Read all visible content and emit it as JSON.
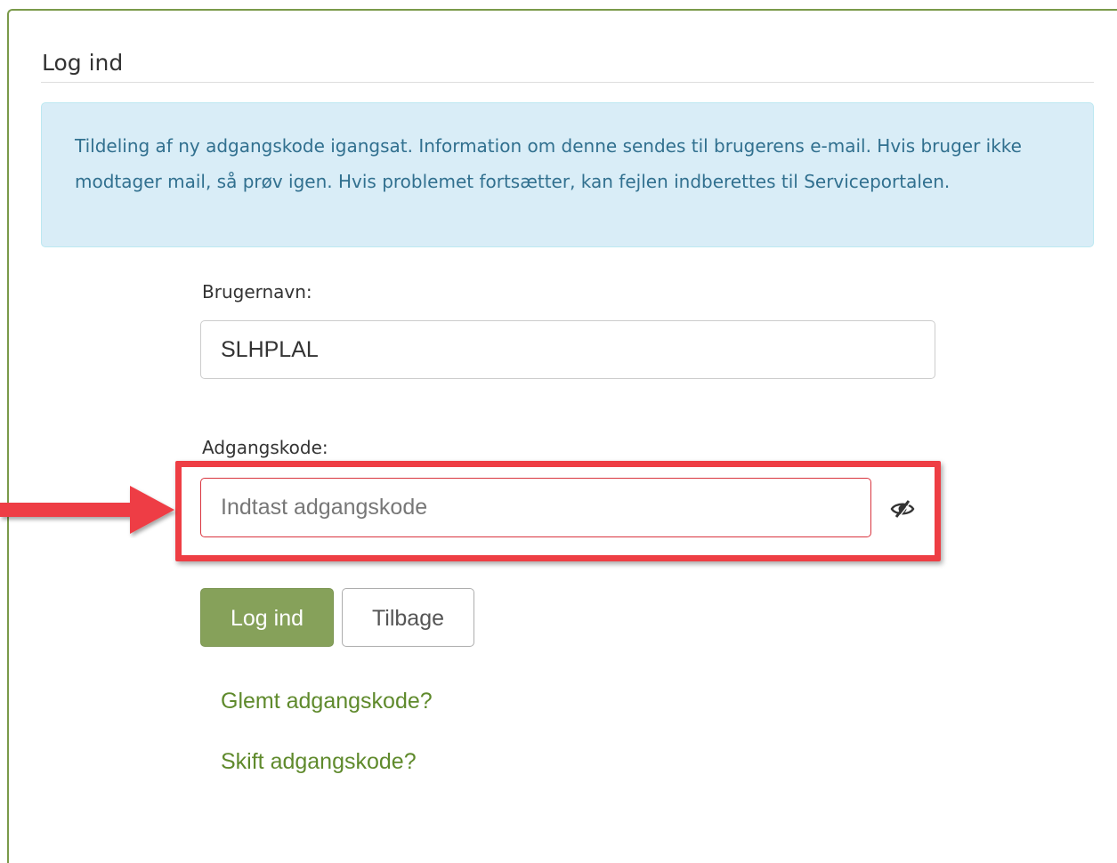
{
  "panel": {
    "title": "Log ind"
  },
  "alert": {
    "message": "Tildeling af ny adgangskode igangsat. Information om denne sendes til brugerens e-mail. Hvis bruger ikke modtager mail, så prøv igen. Hvis problemet fortsætter, kan fejlen indberettes til Serviceportalen."
  },
  "form": {
    "username_label": "Brugernavn:",
    "username_value": "SLHPLAL",
    "password_label": "Adgangskode:",
    "password_placeholder": "Indtast adgangskode",
    "password_value": "",
    "show_password_icon": "eye-slash-icon"
  },
  "buttons": {
    "login_label": "Log ind",
    "back_label": "Tilbage"
  },
  "links": {
    "forgot_password": "Glemt adgangskode?",
    "change_password": "Skift adgangskode?"
  },
  "annotation": {
    "highlight_color": "#ee3e44",
    "arrow_icon": "arrow-right-icon"
  },
  "colors": {
    "accent": "#86a15a",
    "link": "#5f8a2c",
    "alert_bg": "#d9edf7",
    "alert_text": "#31708f",
    "error_border": "#d9353f"
  }
}
